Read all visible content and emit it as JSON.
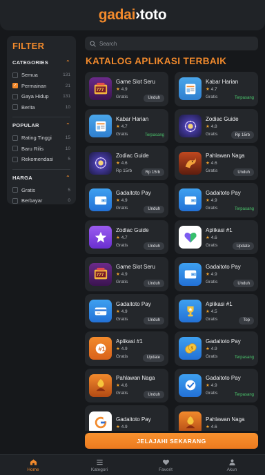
{
  "header": {
    "logo_part1": "gadai",
    "logo_part2": "›toto"
  },
  "filter": {
    "title": "FILTER",
    "sections": [
      {
        "heading": "CATEGORIES",
        "items": [
          {
            "label": "Semua",
            "count": "131",
            "checked": false
          },
          {
            "label": "Permainan",
            "count": "21",
            "checked": true
          },
          {
            "label": "Gaya Hidup",
            "count": "131",
            "checked": false
          },
          {
            "label": "Berita",
            "count": "10",
            "checked": false
          }
        ]
      },
      {
        "heading": "POPULAR",
        "items": [
          {
            "label": "Rating Tinggi",
            "count": "15",
            "checked": false
          },
          {
            "label": "Baru Rilis",
            "count": "10",
            "checked": false
          },
          {
            "label": "Rekomendasi",
            "count": "5",
            "checked": false
          }
        ]
      },
      {
        "heading": "HARGA",
        "items": [
          {
            "label": "Gratis",
            "count": "5",
            "checked": false
          },
          {
            "label": "Berbayar",
            "count": "0",
            "checked": false
          }
        ]
      }
    ]
  },
  "search": {
    "placeholder": "Search"
  },
  "catalog": {
    "title": "KATALOG APLIKASI TERBAIK",
    "apps": [
      {
        "name": "Game Slot Seru",
        "rating": "4.9",
        "price": "Gratis",
        "action": "Unduh",
        "installed": false,
        "icon": "slot-machine-icon"
      },
      {
        "name": "Kabar Harian",
        "rating": "4.7",
        "price": "Gratis",
        "action": "Terpasang",
        "installed": true,
        "icon": "news-icon"
      },
      {
        "name": "Kabar Harian",
        "rating": "4.7",
        "price": "Gratis",
        "action": "Terpasang",
        "installed": true,
        "icon": "news-icon"
      },
      {
        "name": "Zodiac Guide",
        "rating": "4.8",
        "price": "Gratis",
        "action": "Rp 15rb",
        "installed": false,
        "icon": "zodiac-icon"
      },
      {
        "name": "Zodiac Guide",
        "rating": "4.6",
        "price": "Rp 15rb",
        "action": "Rp 15rb",
        "installed": false,
        "icon": "zodiac-icon"
      },
      {
        "name": "Pahlawan Naga",
        "rating": "4.6",
        "price": "Gratis",
        "action": "Unduh",
        "installed": false,
        "icon": "dragon-icon"
      },
      {
        "name": "Gadaitoto Pay",
        "rating": "4.9",
        "price": "Gratis",
        "action": "Unduh",
        "installed": false,
        "icon": "wallet-icon"
      },
      {
        "name": "Gadaitoto Pay",
        "rating": "4.9",
        "price": "Gratis",
        "action": "Terpasang",
        "installed": true,
        "icon": "wallet-icon"
      },
      {
        "name": "Zodiac Guide",
        "rating": "4.7",
        "price": "Gratis",
        "action": "Unduh",
        "installed": false,
        "icon": "star-icon"
      },
      {
        "name": "Aplikasi #1",
        "rating": "4.6",
        "price": "Gratis",
        "action": "Update",
        "installed": false,
        "icon": "heart-icon"
      },
      {
        "name": "Game Slot Seru",
        "rating": "4.9",
        "price": "Gratis",
        "action": "Unduh",
        "installed": false,
        "icon": "slot-machine-icon"
      },
      {
        "name": "Gadaitoto Pay",
        "rating": "4.9",
        "price": "Gratis",
        "action": "Unduh",
        "installed": false,
        "icon": "wallet-icon"
      },
      {
        "name": "Gadaitoto Pay",
        "rating": "4.9",
        "price": "Gratis",
        "action": "Unduh",
        "installed": false,
        "icon": "card-icon"
      },
      {
        "name": "Aplikasi #1",
        "rating": "4.5",
        "price": "Gratis",
        "action": "Top",
        "installed": false,
        "icon": "trophy-icon"
      },
      {
        "name": "Aplikasi #1",
        "rating": "4.9",
        "price": "Gratis",
        "action": "Update",
        "installed": false,
        "icon": "number-one-icon"
      },
      {
        "name": "Gadaitoto Pay",
        "rating": "4.9",
        "price": "Gratis",
        "action": "Terpasang",
        "installed": true,
        "icon": "coins-icon"
      },
      {
        "name": "Pahlawan Naga",
        "rating": "4.6",
        "price": "Gratis",
        "action": "Unduh",
        "installed": false,
        "icon": "warrior-icon"
      },
      {
        "name": "Gadaitoto Pay",
        "rating": "4.9",
        "price": "Gratis",
        "action": "Terpasang",
        "installed": true,
        "icon": "check-shield-icon"
      },
      {
        "name": "Gadaitoto Pay",
        "rating": "4.9",
        "price": "",
        "action": "",
        "installed": false,
        "icon": "g-logo-icon"
      },
      {
        "name": "Pahlawan Naga",
        "rating": "4.6",
        "price": "",
        "action": "",
        "installed": false,
        "icon": "warrior-icon"
      }
    ]
  },
  "cta": {
    "label": "JELAJAHI SEKARANG"
  },
  "nav": [
    {
      "label": "Home",
      "icon": "home-icon",
      "active": true
    },
    {
      "label": "Kategori",
      "icon": "list-icon",
      "active": false
    },
    {
      "label": "Favorit",
      "icon": "heart-icon",
      "active": false
    },
    {
      "label": "Akun",
      "icon": "user-icon",
      "active": false
    }
  ],
  "colors": {
    "accent": "#f28a2c",
    "background": "#16181b",
    "card": "#24272b",
    "installed": "#4cc76d"
  }
}
